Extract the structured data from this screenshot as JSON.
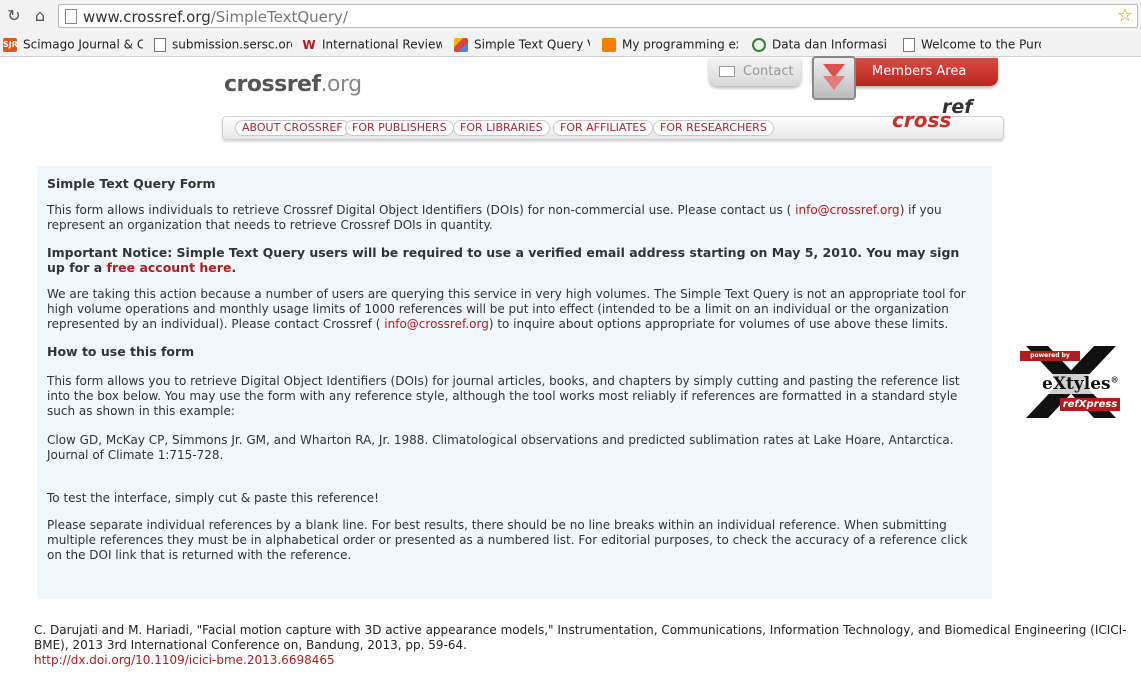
{
  "browser": {
    "url_domain": "www.crossref.org",
    "url_path": "/SimpleTextQuery/",
    "bookmarks": [
      {
        "label": "Scimago Journal & Co",
        "icon": "sjr-icon"
      },
      {
        "label": "submission.sersc.org/i",
        "icon": "page-icon"
      },
      {
        "label": "International Review c",
        "icon": "w-icon"
      },
      {
        "label": "Simple Text Query Ver",
        "icon": "stack-icon"
      },
      {
        "label": "My programming exp",
        "icon": "blogger-icon"
      },
      {
        "label": "Data dan Informasi U",
        "icon": "globe-icon"
      },
      {
        "label": "Welcome to the Purdu",
        "icon": "page-icon"
      }
    ],
    "sjr_text": "SJR"
  },
  "header": {
    "logo_main": "crossref",
    "logo_tld": ".org",
    "contact_label": "Contact",
    "members_label": "Members Area",
    "nav": [
      "ABOUT CROSSREF",
      "FOR PUBLISHERS",
      "FOR LIBRARIES",
      "FOR AFFILIATES",
      "FOR RESEARCHERS"
    ],
    "brand_cross": "cross",
    "brand_ref": "ref"
  },
  "content": {
    "title": "Simple Text Query Form",
    "intro_1": "This form allows individuals to retrieve Crossref Digital Object Identifiers (DOIs) for non-commercial use. Please contact us ( ",
    "intro_email": "info@crossref.org",
    "intro_2": ") if you represent an organization that needs to retrieve Crossref DOIs in quantity.",
    "notice_1": "Important Notice: Simple Text Query users will be required to use a verified email address starting on May 5, 2010. You may sign up for a ",
    "notice_link": "free account here",
    "notice_2": ".",
    "action_1": "We are taking this action because a number of users are querying this service in very high volumes. The Simple Text Query is not an appropriate tool for high volume operations and monthly usage limits of 1000 references will be put into effect (intended to be a limit on an individual or the organization represented by an individual). Please contact Crossref ( ",
    "action_email": "info@crossref.org",
    "action_2": ") to inquire about options appropriate for volumes of use above these limits.",
    "howto_title": "How to use this form",
    "howto_text": "This form allows you to retrieve Digital Object Identifiers (DOIs) for journal articles, books, and chapters by simply cutting and pasting the reference list into the box below. You may use the form with any reference style, although the tool works most reliably if references are formatted in a standard style such as shown in this example:",
    "example": "Clow GD, McKay CP, Simmons Jr. GM, and Wharton RA, Jr. 1988. Climatological observations and predicted sublimation rates at Lake Hoare, Antarctica. Journal of Climate 1:715-728.",
    "test_text": "To test the interface, simply cut & paste this reference!",
    "separate_text": "Please separate individual references by a blank line. For best results, there should be no line breaks within an individual reference. When submitting multiple references they must be in alphabetical order or presented as a numbered list. For editorial purposes, to check the accuracy of a reference click on the DOI link that is returned with the reference."
  },
  "badge": {
    "powered": "powered by",
    "brand": "eXtyles",
    "reg": "®",
    "sub": "refXpress"
  },
  "citation": {
    "text": "C. Darujati and M. Hariadi, \"Facial motion capture with 3D active appearance models,\" Instrumentation, Communications, Information Technology, and Biomedical Engineering (ICICI-BME), 2013 3rd International Conference on, Bandung, 2013, pp. 59-64.",
    "doi": "http://dx.doi.org/10.1109/icici-bme.2013.6698465"
  },
  "colors": {
    "accent": "#b01d1d",
    "panel_bg": "#f1f6fc",
    "members_red": "#c8302c"
  }
}
